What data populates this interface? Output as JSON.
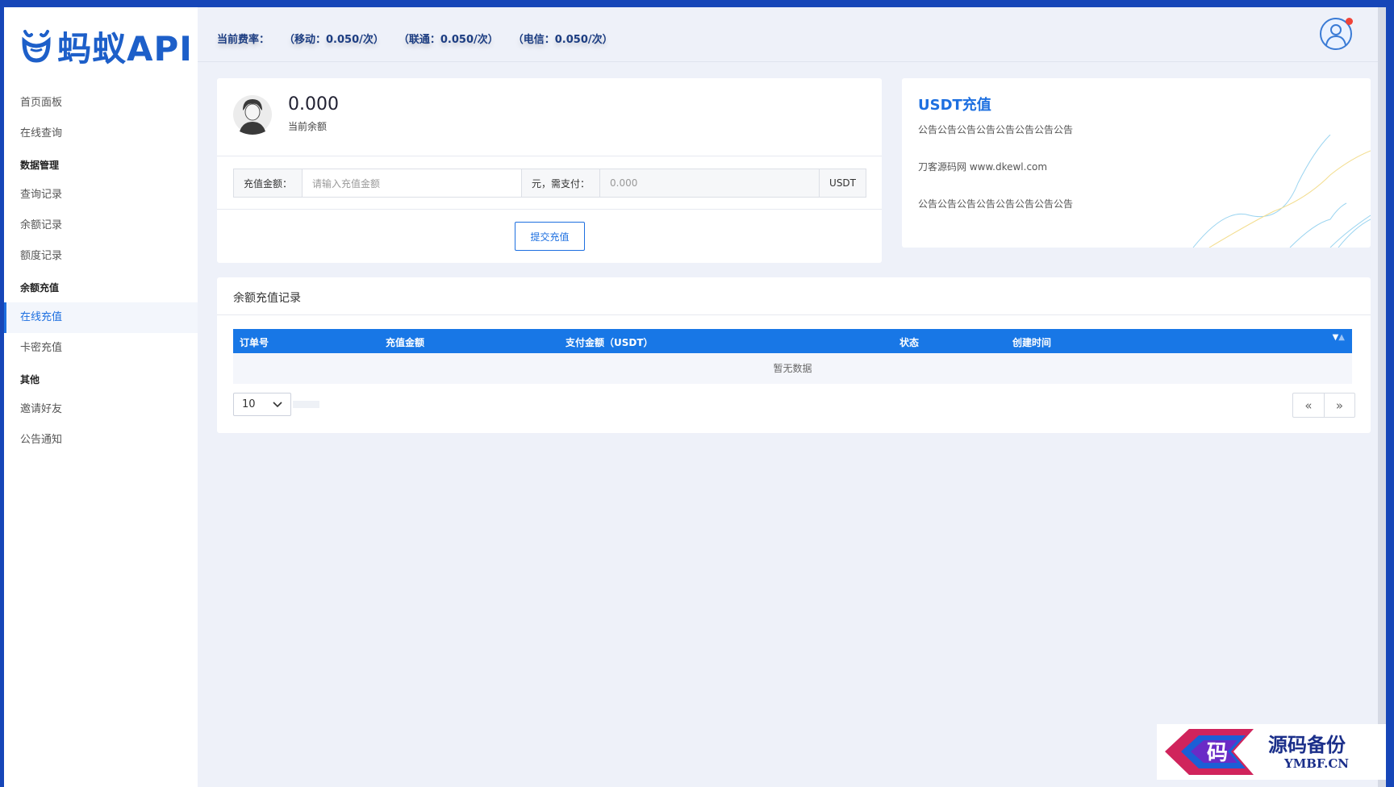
{
  "app": {
    "logo_text": "蚂蚁API"
  },
  "sidebar": {
    "items": [
      {
        "label": "首页面板"
      },
      {
        "label": "在线查询"
      },
      {
        "label": "数据管理"
      },
      {
        "label": "查询记录"
      },
      {
        "label": "余额记录"
      },
      {
        "label": "额度记录"
      },
      {
        "label": "余额充值"
      },
      {
        "label": "在线充值"
      },
      {
        "label": "卡密充值"
      },
      {
        "label": "其他"
      },
      {
        "label": "邀请好友"
      },
      {
        "label": "公告通知"
      }
    ],
    "active": "在线充值"
  },
  "header": {
    "rate_label": "当前费率：",
    "rates": [
      "（移动：0.050/次）",
      "（联通：0.050/次）",
      "（电信：0.050/次）"
    ],
    "notification": true
  },
  "balance": {
    "value": "0.000",
    "label": "当前余额",
    "amount_label": "充值金额：",
    "amount_placeholder": "请输入充值金额",
    "pay_label": "元，需支付：",
    "pay_placeholder": "0.000",
    "currency": "USDT",
    "submit_label": "提交充值"
  },
  "usdt": {
    "title": "USDT充值",
    "notices": [
      "公告公告公告公告公告公告公告公告",
      "刀客源码网 www.dkewl.com",
      "公告公告公告公告公告公告公告公告"
    ]
  },
  "records": {
    "title": "余额充值记录",
    "columns": [
      "订单号",
      "充值金额",
      "支付金额（USDT）",
      "状态",
      "创建时间"
    ],
    "empty_text": "暂无数据",
    "page_size": "10",
    "prev": "«",
    "next": "»"
  },
  "watermark": {
    "text": "源码备份",
    "domain": "YMBF.CN",
    "glyph": "码"
  },
  "colors": {
    "primary": "#1d6fe0",
    "table_header": "#1877e6",
    "frame": "#1646b8",
    "background": "#eef1f9"
  }
}
